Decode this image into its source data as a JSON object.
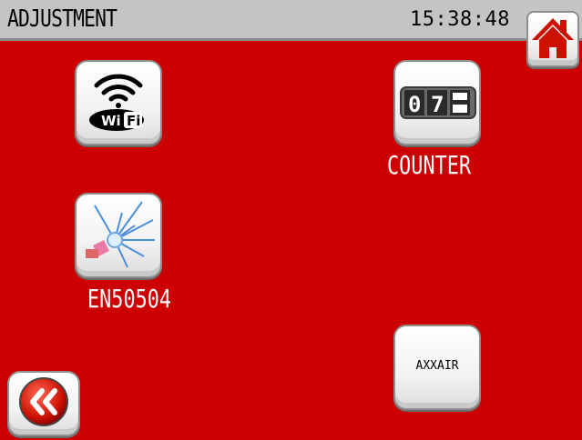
{
  "header": {
    "title": "ADJUSTMENT",
    "time": "15:38:48"
  },
  "buttons": {
    "wifi": {
      "icon": "wifi-icon",
      "text": "WiFi"
    },
    "counter": {
      "icon": "counter-icon",
      "label": "COUNTER",
      "digits": [
        "0",
        "7"
      ]
    },
    "en50504": {
      "icon": "welding-spark-icon",
      "label": "EN50504"
    },
    "axxair": {
      "label": "AXXAIR"
    },
    "home": {
      "icon": "home-icon"
    },
    "back": {
      "icon": "double-chevron-left-icon"
    }
  },
  "colors": {
    "background": "#cc0000",
    "titlebar": "#c4c4c4",
    "home_icon": "#cc1100"
  }
}
